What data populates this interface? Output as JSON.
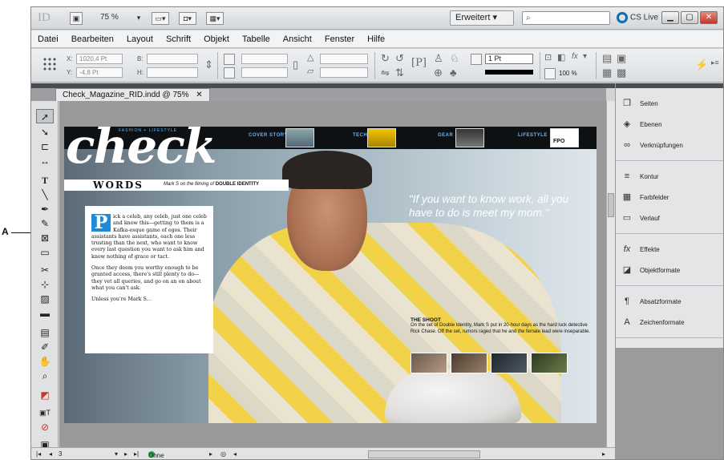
{
  "callout": {
    "label": "A"
  },
  "appbar": {
    "logo": "ID",
    "zoom": "75 %",
    "workspace": "Erweitert",
    "cs_live": "CS Live"
  },
  "menu": [
    "Datei",
    "Bearbeiten",
    "Layout",
    "Schrift",
    "Objekt",
    "Tabelle",
    "Ansicht",
    "Fenster",
    "Hilfe"
  ],
  "control": {
    "x_label": "X:",
    "x_value": "1020,4 Pt",
    "y_label": "Y:",
    "y_value": "-4,8 Pt",
    "w_label": "B:",
    "h_label": "H:",
    "stroke_weight": "1 Pt",
    "scale": "100 %"
  },
  "document_tab": "Check_Magazine_RID.indd @ 75%",
  "magazine": {
    "kicker": "FASHION + LIFESTYLE",
    "brand": "check",
    "nav": [
      "COVER STORY",
      "TECH",
      "GEAR",
      "LIFESTYLE"
    ],
    "nav_tag": "FPO",
    "words": "WORDS",
    "words_sub": "Mark S on the filming of",
    "words_sub_bold": "DOUBLE IDENTITY",
    "dropcap": "P",
    "p1": "ick a celeb, any celeb, just one celeb and know this—getting to them is a Kafka-esque game of egos. Their assistants have assistants, each one less trusting than the next, who want to know every last question you want to ask him and know nothing of grace or tact.",
    "p2": "Once they deem you worthy enough to be granted access, there's still plenty to do—they vet all queries, and go on an on about what you can't ask.",
    "p3": "Unless you're Mark S…",
    "quote": "\"If you want to know work, all you have to do is meet my mom.\"",
    "shoot_title": "THE SHOOT",
    "shoot_text": "On the set of Double Identity, Mark S put in 20-hour days as the hard luck detective Rick Chase. Off the set, rumors raged that he and the female lead were inseparable."
  },
  "panels": [
    {
      "icon": "pages-icon",
      "glyph": "❐",
      "label": "Seiten"
    },
    {
      "icon": "layers-icon",
      "glyph": "◈",
      "label": "Ebenen"
    },
    {
      "icon": "links-icon",
      "glyph": "∞",
      "label": "Verknüpfungen"
    },
    {
      "icon": "stroke-icon",
      "glyph": "≡",
      "label": "Kontur"
    },
    {
      "icon": "swatches-icon",
      "glyph": "▦",
      "label": "Farbfelder"
    },
    {
      "icon": "gradient-icon",
      "glyph": "▭",
      "label": "Verlauf"
    },
    {
      "icon": "effects-icon",
      "glyph": "fx",
      "label": "Effekte"
    },
    {
      "icon": "object-styles-icon",
      "glyph": "◪",
      "label": "Objektformate"
    },
    {
      "icon": "paragraph-styles-icon",
      "glyph": "¶",
      "label": "Absatzformate"
    },
    {
      "icon": "character-styles-icon",
      "glyph": "A",
      "label": "Zeichenformate"
    }
  ],
  "status": {
    "page": "3",
    "preflight": "Ohne Fehler"
  }
}
